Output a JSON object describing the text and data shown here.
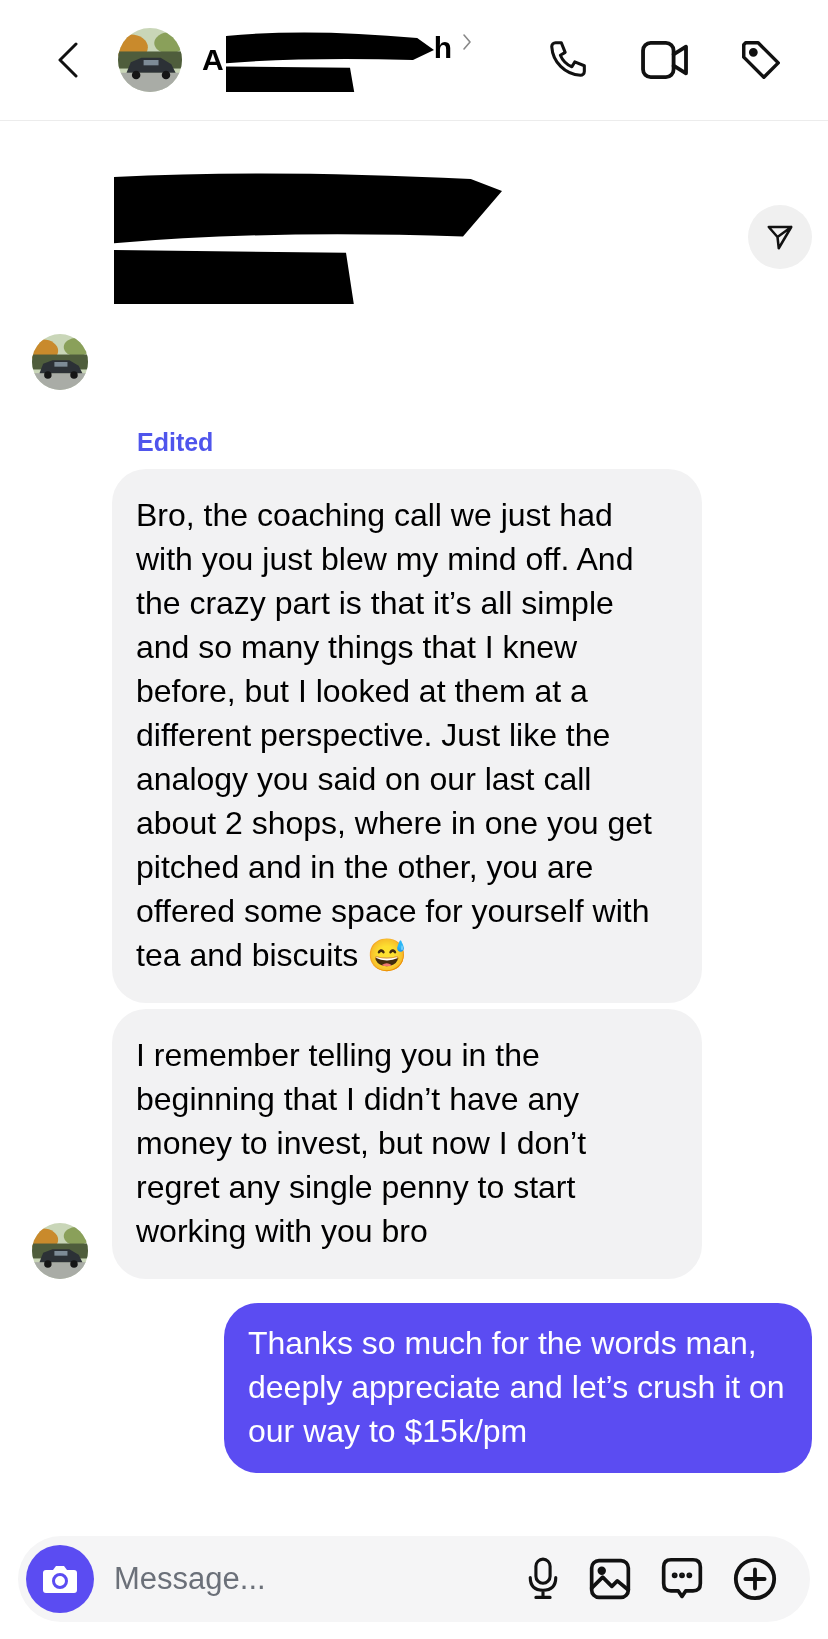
{
  "header": {
    "name_start": "A",
    "name_end": "h",
    "redacted": true
  },
  "messages": [
    {
      "kind": "redacted",
      "share_button": true
    },
    {
      "kind": "empty",
      "show_avatar": true
    },
    {
      "kind": "label",
      "text": "Edited"
    },
    {
      "kind": "incoming",
      "show_avatar": false,
      "text": "Bro, the coaching call we just had with you just blew my mind off. And the crazy part is that it’s all simple and so many things that I knew before, but I looked at them at a different perspective. Just like the analogy you said on our last call about 2 shops, where in one you get pitched and in the other, you are offered some space for yourself with tea and biscuits 😅"
    },
    {
      "kind": "incoming",
      "show_avatar": true,
      "text": "I remember telling you in the beginning that I didn’t have any money to invest, but now I don’t regret any single penny to start working with you bro"
    },
    {
      "kind": "outgoing",
      "text": "Thanks so much for the words man, deeply appreciate and let’s crush it on our way to $15k/pm"
    }
  ],
  "composer": {
    "placeholder": "Message..."
  }
}
